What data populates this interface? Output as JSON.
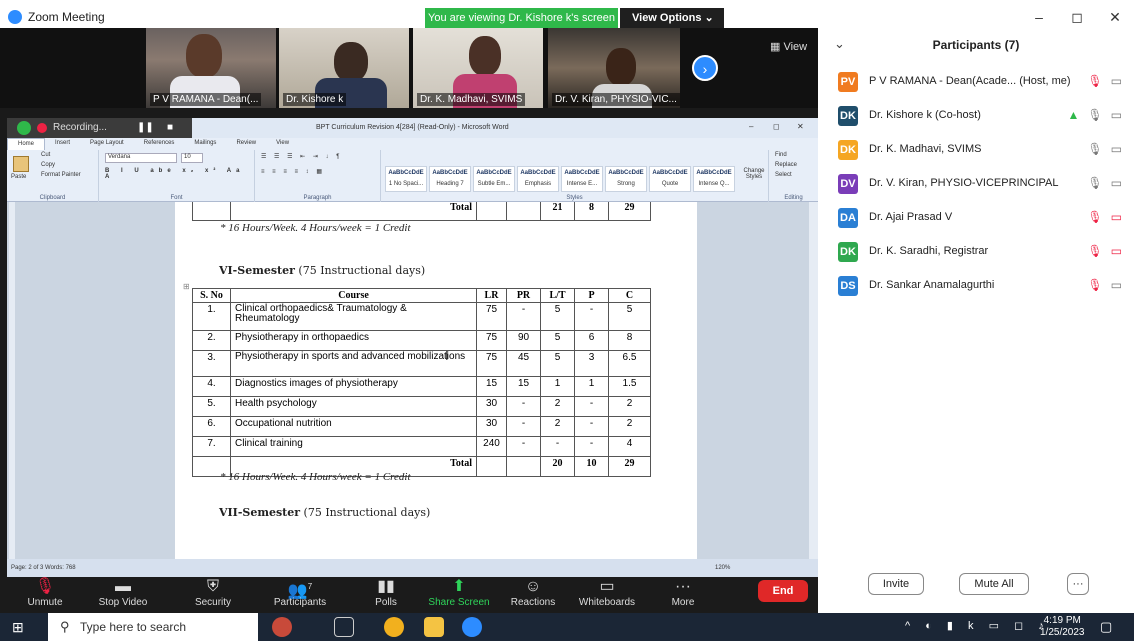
{
  "titlebar": {
    "title": "Zoom Meeting",
    "viewing": "You are viewing Dr. Kishore k's screen",
    "view_options": "View Options",
    "minimize": "–",
    "restore": "◻",
    "close": "✕"
  },
  "gallery": {
    "tiles": [
      {
        "name": "P V RAMANA - Dean(..."
      },
      {
        "name": "Dr. Kishore k"
      },
      {
        "name": "Dr. K. Madhavi, SVIMS"
      },
      {
        "name": "Dr. V. Kiran, PHYSIO-VIC..."
      }
    ],
    "view": "View"
  },
  "word": {
    "recording": "Recording...",
    "doc_title": "BPT Curriculum Revision 4[284] (Read-Only) - Microsoft Word",
    "tabs": [
      "Home",
      "Insert",
      "Page Layout",
      "References",
      "Mailings",
      "Review",
      "View"
    ],
    "clipboard": {
      "cut": "Cut",
      "copy": "Copy",
      "paste": "Paste",
      "format_painter": "Format Painter",
      "label": "Clipboard"
    },
    "font": {
      "name": "Verdana",
      "size": "10",
      "label": "Font"
    },
    "paragraph_label": "Paragraph",
    "styles": [
      {
        "sample": "AaBbCcDdE",
        "name": "1 No Spaci..."
      },
      {
        "sample": "AaBbCcDdE",
        "name": "Heading 7"
      },
      {
        "sample": "AaBbCcDdE",
        "name": "Subtle Em..."
      },
      {
        "sample": "AaBbCcDdE",
        "name": "Emphasis"
      },
      {
        "sample": "AaBbCcDdE",
        "name": "Intense E..."
      },
      {
        "sample": "AaBbCcDdE",
        "name": "Strong"
      },
      {
        "sample": "AaBbCcDdE",
        "name": "Quote"
      },
      {
        "sample": "AaBbCcDdE",
        "name": "Intense Q..."
      }
    ],
    "styles_label": "Styles",
    "change_styles": "Change Styles",
    "editing": {
      "find": "Find",
      "replace": "Replace",
      "select": "Select",
      "label": "Editing"
    },
    "status": "Page: 2 of 3   Words: 768",
    "zoom": "120%"
  },
  "doc": {
    "prev_total": {
      "label": "Total",
      "lt": "21",
      "p": "8",
      "c": "29"
    },
    "note1": "* 16 Hours/Week. 4 Hours/week = 1 Credit",
    "sem6_bold": "VI-Semester",
    "sem6_rest": " (75 Instructional days)",
    "headers": [
      "S. No",
      "Course",
      "LR",
      "PR",
      "L/T",
      "P",
      "C"
    ],
    "rows": [
      [
        "1.",
        "Clinical orthopaedics& Traumatology & Rheumatology",
        "75",
        "-",
        "5",
        "-",
        "5"
      ],
      [
        "2.",
        "Physiotherapy in orthopaedics",
        "75",
        "90",
        "5",
        "6",
        "8"
      ],
      [
        "3.",
        "Physiotherapy in sports and advanced mobilizations",
        "75",
        "45",
        "5",
        "3",
        "6.5"
      ],
      [
        "4.",
        "Diagnostics images of physiotherapy",
        "15",
        "15",
        "1",
        "1",
        "1.5"
      ],
      [
        "5.",
        "Health psychology",
        "30",
        "-",
        "2",
        "-",
        "2"
      ],
      [
        "6.",
        "Occupational nutrition",
        "30",
        "-",
        "2",
        "-",
        "2"
      ],
      [
        "7.",
        "Clinical training",
        "240",
        "-",
        "-",
        "-",
        "4"
      ]
    ],
    "total": {
      "label": "Total",
      "lt": "20",
      "p": "10",
      "c": "29"
    },
    "note2": "* 16 Hours/Week. 4 Hours/week = 1 Credit",
    "sem7_bold": "VII-Semester",
    "sem7_rest": " (75 Instructional days)"
  },
  "participants": {
    "title": "Participants (7)",
    "list": [
      {
        "initials": "PV",
        "color": "#f07b20",
        "name": "P V RAMANA - Dean(Acade...  (Host, me)"
      },
      {
        "initials": "DK",
        "color": "#1f4e6b",
        "name": "Dr. Kishore k (Co-host)"
      },
      {
        "initials": "DK",
        "color": "#f5a623",
        "name": "Dr. K. Madhavi, SVIMS"
      },
      {
        "initials": "DV",
        "color": "#7a3db8",
        "name": "Dr. V. Kiran, PHYSIO-VICEPRINCIPAL"
      },
      {
        "initials": "DA",
        "color": "#2a7fd4",
        "name": "Dr. Ajai Prasad V"
      },
      {
        "initials": "DK",
        "color": "#2fa84f",
        "name": "Dr. K. Saradhi, Registrar"
      },
      {
        "initials": "DS",
        "color": "#2a7fd4",
        "name": "Dr. Sankar Anamalagurthi"
      }
    ],
    "invite": "Invite",
    "mute_all": "Mute All",
    "more": "···"
  },
  "toolbar": {
    "unmute": "Unmute",
    "stop_video": "Stop Video",
    "security": "Security",
    "participants": "Participants",
    "participants_count": "7",
    "polls": "Polls",
    "share_screen": "Share Screen",
    "reactions": "Reactions",
    "whiteboards": "Whiteboards",
    "more": "More",
    "end": "End"
  },
  "taskbar": {
    "search": "Type here to search",
    "time": "4:19 PM",
    "date": "1/25/2023"
  }
}
